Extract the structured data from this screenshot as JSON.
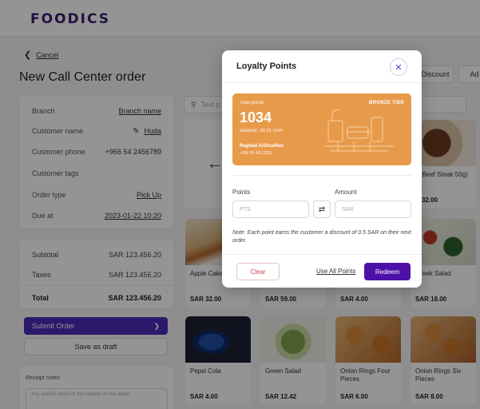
{
  "brand": {
    "logo": "FOODICS"
  },
  "header": {
    "back_label": "Cancel",
    "page_title": "New Call Center order"
  },
  "toolbar": {
    "discount_label": "Discount",
    "add_label": "Ad"
  },
  "order_info": {
    "branch_label": "Branch",
    "branch_value": "Branch name",
    "customer_name_label": "Customer name",
    "customer_name_value": "Huda",
    "customer_phone_label": "Customer phone",
    "customer_phone_value": "+966 54 2456789",
    "customer_tags_label": "Customer tags",
    "order_type_label": "Order type",
    "order_type_value": "Pick Up",
    "due_at_label": "Due at",
    "due_at_value": "2023-01-22 10:20"
  },
  "totals": {
    "subtotal_label": "Subtotal",
    "subtotal_value": "SAR 123.456.20",
    "taxes_label": "Taxes",
    "taxes_value": "SAR 123.456.20",
    "total_label": "Total",
    "total_value": "SAR 123.456.20"
  },
  "actions": {
    "submit_label": "Submit Order",
    "draft_label": "Save as draft"
  },
  "notes": {
    "label": "Receipt notes",
    "placeholder": "Any specific need for this cashier on the order!"
  },
  "search": {
    "placeholder": "Text p"
  },
  "products": [
    {
      "name": "Apple Cake",
      "price": "SAR 32.00"
    },
    {
      "name": "",
      "price": "SAR 59.00"
    },
    {
      "name": "",
      "price": "SAR 4.00"
    },
    {
      "name": "Greek Salad",
      "price": "SAR 18.00"
    },
    {
      "name": "Pepsi Cola",
      "price": "SAR 4.00"
    },
    {
      "name": "Green Salad",
      "price": "SAR 12.42"
    },
    {
      "name": "Onion Rings Four Pieces",
      "price": "SAR 6.00"
    },
    {
      "name": "Onion Rings Six Pieces",
      "price": "SAR 8.00"
    },
    {
      "name": "al Beef Steak 50g)",
      "price": "R 32.00"
    }
  ],
  "modal": {
    "title": "Loyalty Points",
    "card": {
      "total_points_label": "Total points",
      "tier": "BRONZE TIER",
      "points": "1034",
      "balance": "Balance: 39.31 SAR",
      "customer_name": "Raghad AlShualfan",
      "customer_phone": "+966 55 493 2253"
    },
    "points_label": "Points",
    "points_placeholder": "PTS",
    "amount_label": "Amount",
    "amount_placeholder": "SAR",
    "note": "Note: Each point earns the customer a discount of 0.5 SAR on their next order.",
    "clear_label": "Clear",
    "use_all_label": "Use All Points",
    "redeem_label": "Redeem"
  },
  "colors": {
    "brand": "#3b1d6e",
    "primary": "#4e11a8",
    "loyalty_card": "#e89a4b",
    "danger": "#d64545"
  }
}
